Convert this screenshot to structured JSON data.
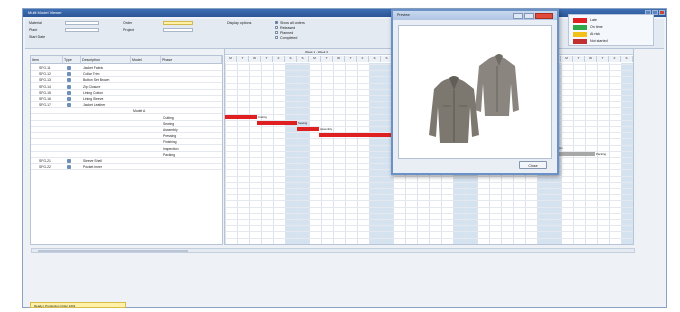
{
  "window": {
    "title": "Multi Model Viewer"
  },
  "header": {
    "fields": [
      {
        "label": "Material",
        "value": ""
      },
      {
        "label": "Plant",
        "value": ""
      },
      {
        "label": "Order",
        "value": ""
      },
      {
        "label": "Project",
        "value": ""
      },
      {
        "label": "Start Date",
        "value": ""
      }
    ],
    "options_title": "Display options",
    "options": [
      {
        "label": "Show all orders",
        "checked": true
      },
      {
        "label": "Released",
        "checked": false
      },
      {
        "label": "Planned",
        "checked": false
      },
      {
        "label": "Completed",
        "checked": false
      }
    ]
  },
  "grid": {
    "columns": [
      "Item",
      "Type",
      "Description",
      "Model",
      "Phase"
    ],
    "rows": [
      {
        "item": "SFG-11",
        "desc": "Jacket Fabric",
        "model": "",
        "phase": ""
      },
      {
        "item": "SFG-12",
        "desc": "Collar Trim",
        "model": "",
        "phase": ""
      },
      {
        "item": "SFG-13",
        "desc": "Button Set Brown",
        "model": "",
        "phase": ""
      },
      {
        "item": "SFG-14",
        "desc": "Zip Closure",
        "model": "",
        "phase": ""
      },
      {
        "item": "SFG-15",
        "desc": "Lining Cotton",
        "model": "",
        "phase": ""
      },
      {
        "item": "SFG-16",
        "desc": "Lining Sleeve",
        "model": "",
        "phase": ""
      },
      {
        "item": "SFG-17",
        "desc": "Jacket Leather",
        "model": "",
        "phase": ""
      }
    ],
    "phases": [
      "Cutting",
      "Sewing",
      "Assembly",
      "Pressing",
      "Finishing",
      "Inspection",
      "Packing"
    ],
    "rows_tail": [
      {
        "item": "SFG-21",
        "desc": "Sleeve Shell"
      },
      {
        "item": "SFG-22",
        "desc": "Pocket Inner"
      }
    ],
    "model_caption": "Model A"
  },
  "gantt": {
    "range_label": "Week 1 - Week 3",
    "days": [
      "M",
      "T",
      "W",
      "T",
      "F",
      "S",
      "S",
      "M",
      "T",
      "W",
      "T",
      "F",
      "S",
      "S",
      "M",
      "T",
      "W",
      "T",
      "F",
      "S",
      "S",
      "M",
      "T",
      "W",
      "T",
      "F",
      "S",
      "S",
      "M",
      "T",
      "W",
      "T",
      "F",
      "S"
    ],
    "bars": [
      {
        "label": "Cutting",
        "color": "red"
      },
      {
        "label": "Sewing",
        "color": "red"
      },
      {
        "label": "Assembly",
        "color": "red"
      },
      {
        "label": "Pressing",
        "color": "red"
      },
      {
        "label": "Finishing",
        "color": "red"
      },
      {
        "label": "Inspection",
        "color": "gray"
      },
      {
        "label": "Packing",
        "color": "gray"
      }
    ]
  },
  "legend": {
    "items": [
      {
        "label": "Late",
        "color": "#e02020"
      },
      {
        "label": "On time",
        "color": "#2fa84a"
      },
      {
        "label": "At risk",
        "color": "#f2c21b"
      },
      {
        "label": "Not started",
        "color": "#c03030"
      }
    ]
  },
  "dialog": {
    "title": "Preview",
    "ok_label": "Close",
    "image_alt": "Two grey jackets"
  },
  "statusbar": {
    "text": "Ready | Production Order 1001"
  },
  "colors": {
    "accent": "#2b5597",
    "bar_red": "#e02020",
    "bar_gray": "#a8a8a8",
    "weekend": "#d5e2f0"
  }
}
